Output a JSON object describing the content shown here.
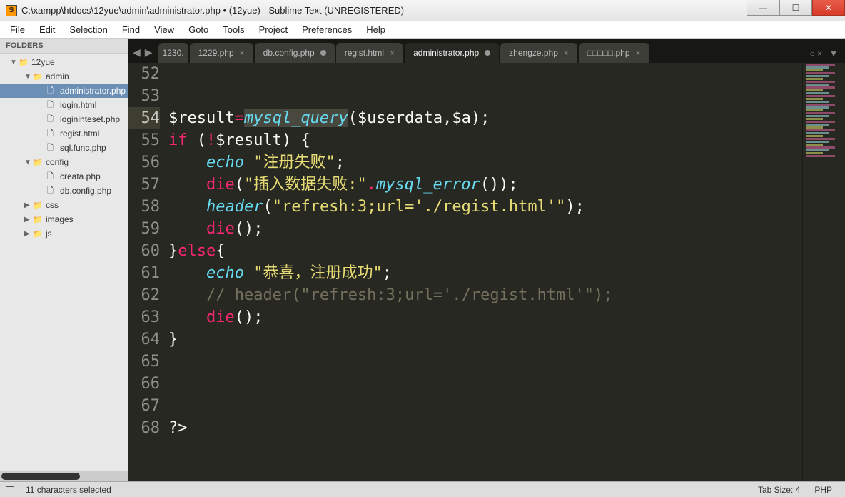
{
  "window": {
    "title": "C:\\xampp\\htdocs\\12yue\\admin\\administrator.php • (12yue) - Sublime Text (UNREGISTERED)"
  },
  "menu": [
    "File",
    "Edit",
    "Selection",
    "Find",
    "View",
    "Goto",
    "Tools",
    "Project",
    "Preferences",
    "Help"
  ],
  "sidebar": {
    "header": "FOLDERS",
    "tree": [
      {
        "depth": 1,
        "arrow": "▼",
        "icon": "📁",
        "label": "12yue"
      },
      {
        "depth": 2,
        "arrow": "▼",
        "icon": "📁",
        "label": "admin"
      },
      {
        "depth": 3,
        "arrow": "",
        "icon": "🗋",
        "label": "administrator.php",
        "sel": true
      },
      {
        "depth": 3,
        "arrow": "",
        "icon": "🗋",
        "label": "login.html"
      },
      {
        "depth": 3,
        "arrow": "",
        "icon": "🗋",
        "label": "logininteset.php"
      },
      {
        "depth": 3,
        "arrow": "",
        "icon": "🗋",
        "label": "regist.html"
      },
      {
        "depth": 3,
        "arrow": "",
        "icon": "🗋",
        "label": "sql.func.php"
      },
      {
        "depth": 2,
        "arrow": "▼",
        "icon": "📁",
        "label": "config"
      },
      {
        "depth": 3,
        "arrow": "",
        "icon": "🗋",
        "label": "creata.php"
      },
      {
        "depth": 3,
        "arrow": "",
        "icon": "🗋",
        "label": "db.config.php"
      },
      {
        "depth": 2,
        "arrow": "▶",
        "icon": "📁",
        "label": "css"
      },
      {
        "depth": 2,
        "arrow": "▶",
        "icon": "📁",
        "label": "images"
      },
      {
        "depth": 2,
        "arrow": "▶",
        "icon": "📁",
        "label": "js"
      }
    ]
  },
  "tabs": [
    {
      "label": "1230.",
      "dirty": false,
      "close": false,
      "active": false,
      "narrow": true
    },
    {
      "label": "1229.php",
      "dirty": false,
      "close": true,
      "active": false
    },
    {
      "label": "db.config.php",
      "dirty": true,
      "close": false,
      "active": false
    },
    {
      "label": "regist.html",
      "dirty": false,
      "close": true,
      "active": false
    },
    {
      "label": "administrator.php",
      "dirty": true,
      "close": false,
      "active": true
    },
    {
      "label": "zhengze.php",
      "dirty": false,
      "close": true,
      "active": false
    },
    {
      "label": "□□□□□.php",
      "dirty": false,
      "close": true,
      "active": false
    }
  ],
  "tabExtra": "○ ×",
  "code": {
    "start": 52,
    "highlight": 54,
    "lines": [
      {
        "n": 52,
        "seg": [
          {
            "c": "tok-var",
            "t": ""
          }
        ]
      },
      {
        "n": 53,
        "seg": [
          {
            "c": "tok-var",
            "t": ""
          }
        ]
      },
      {
        "n": 54,
        "seg": [
          {
            "c": "tok-var",
            "t": "$result"
          },
          {
            "c": "tok-op",
            "t": "="
          },
          {
            "c": "tok-fn sel",
            "t": "mysql_query"
          },
          {
            "c": "tok-var",
            "t": "($userdata,$a);"
          }
        ]
      },
      {
        "n": 55,
        "seg": [
          {
            "c": "tok-kw",
            "t": "if"
          },
          {
            "c": "tok-var",
            "t": " ("
          },
          {
            "c": "tok-op",
            "t": "!"
          },
          {
            "c": "tok-var",
            "t": "$result) {"
          }
        ]
      },
      {
        "n": 56,
        "seg": [
          {
            "c": "tok-var",
            "t": "    "
          },
          {
            "c": "tok-fn",
            "t": "echo"
          },
          {
            "c": "tok-var",
            "t": " "
          },
          {
            "c": "tok-str",
            "t": "\"注册失败\""
          },
          {
            "c": "tok-var",
            "t": ";"
          }
        ]
      },
      {
        "n": 57,
        "seg": [
          {
            "c": "tok-var",
            "t": "    "
          },
          {
            "c": "tok-kw",
            "t": "die"
          },
          {
            "c": "tok-var",
            "t": "("
          },
          {
            "c": "tok-str",
            "t": "\"插入数据失败:\""
          },
          {
            "c": "tok-op",
            "t": "."
          },
          {
            "c": "tok-fn",
            "t": "mysql_error"
          },
          {
            "c": "tok-var",
            "t": "());"
          }
        ]
      },
      {
        "n": 58,
        "seg": [
          {
            "c": "tok-var",
            "t": "    "
          },
          {
            "c": "tok-fn",
            "t": "header"
          },
          {
            "c": "tok-var",
            "t": "("
          },
          {
            "c": "tok-str",
            "t": "\"refresh:3;url='./regist.html'\""
          },
          {
            "c": "tok-var",
            "t": ");"
          }
        ]
      },
      {
        "n": 59,
        "seg": [
          {
            "c": "tok-var",
            "t": "    "
          },
          {
            "c": "tok-kw",
            "t": "die"
          },
          {
            "c": "tok-var",
            "t": "();"
          }
        ]
      },
      {
        "n": 60,
        "seg": [
          {
            "c": "tok-var",
            "t": "}"
          },
          {
            "c": "tok-kw",
            "t": "else"
          },
          {
            "c": "tok-var",
            "t": "{"
          }
        ]
      },
      {
        "n": 61,
        "seg": [
          {
            "c": "tok-var",
            "t": "    "
          },
          {
            "c": "tok-fn",
            "t": "echo"
          },
          {
            "c": "tok-var",
            "t": " "
          },
          {
            "c": "tok-str",
            "t": "\"恭喜，注册成功\""
          },
          {
            "c": "tok-var",
            "t": ";"
          }
        ]
      },
      {
        "n": 62,
        "seg": [
          {
            "c": "tok-var",
            "t": "    "
          },
          {
            "c": "tok-cm",
            "t": "// header(\"refresh:3;url='./regist.html'\");"
          }
        ]
      },
      {
        "n": 63,
        "seg": [
          {
            "c": "tok-var",
            "t": "    "
          },
          {
            "c": "tok-kw",
            "t": "die"
          },
          {
            "c": "tok-var",
            "t": "();"
          }
        ]
      },
      {
        "n": 64,
        "seg": [
          {
            "c": "tok-var",
            "t": "}"
          }
        ]
      },
      {
        "n": 65,
        "seg": [
          {
            "c": "tok-var",
            "t": ""
          }
        ]
      },
      {
        "n": 66,
        "seg": [
          {
            "c": "tok-var",
            "t": ""
          }
        ]
      },
      {
        "n": 67,
        "seg": [
          {
            "c": "tok-var",
            "t": ""
          }
        ]
      },
      {
        "n": 68,
        "seg": [
          {
            "c": "tok-var",
            "t": "?>"
          }
        ]
      }
    ]
  },
  "status": {
    "left": "11 characters selected",
    "tabsize": "Tab Size: 4",
    "syntax": "PHP"
  }
}
